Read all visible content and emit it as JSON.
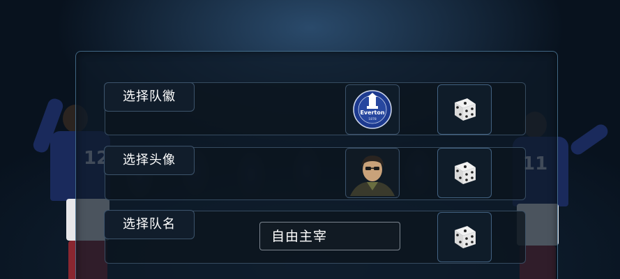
{
  "rows": [
    {
      "label": "选择队徽"
    },
    {
      "label": "选择头像"
    },
    {
      "label": "选择队名"
    }
  ],
  "team_crest": {
    "name": "Everton",
    "year": "1878",
    "motto": "NIL SATIS NISI OPTIMUM",
    "color": "#1d3a8f"
  },
  "team_name_value": "自由主宰",
  "background": {
    "player_left_number": "12",
    "player_right_number": "11"
  },
  "icons": {
    "dice": "dice-icon",
    "crest": "everton-crest-icon",
    "avatar": "manager-avatar"
  },
  "colors": {
    "panel_border": "#6eaad2",
    "row_bg": "#0c141e",
    "text": "#ffffff",
    "kit_blue": "#1a2a5c"
  }
}
